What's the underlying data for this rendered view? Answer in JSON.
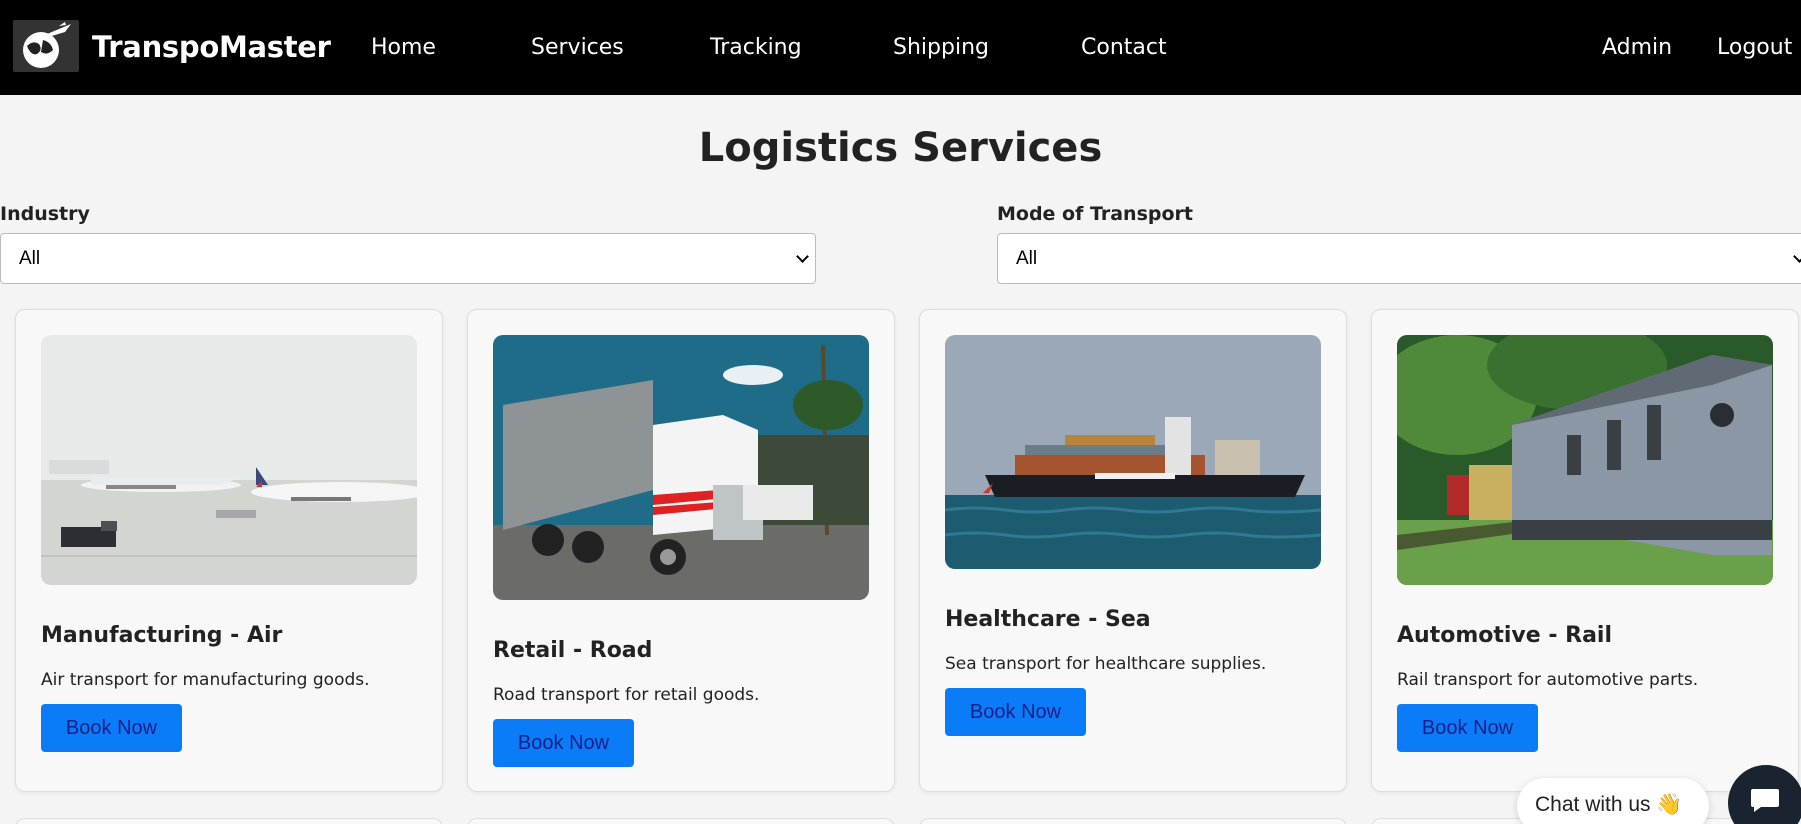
{
  "navbar": {
    "brand": "TranspoMaster",
    "logo_icon": "globe-plane-logo-icon",
    "links": [
      "Home",
      "Services",
      "Tracking",
      "Shipping",
      "Contact"
    ],
    "right_links": [
      "Admin",
      "Logout"
    ]
  },
  "page": {
    "title": "Logistics Services"
  },
  "filters": {
    "industry": {
      "label": "Industry",
      "value": "All"
    },
    "transport": {
      "label": "Mode of Transport",
      "value": "All"
    }
  },
  "cards": [
    {
      "title": "Manufacturing - Air",
      "description": "Air transport for manufacturing goods.",
      "button": "Book Now",
      "image_icon": "airplanes-photo"
    },
    {
      "title": "Retail - Road",
      "description": "Road transport for retail goods.",
      "button": "Book Now",
      "image_icon": "truck-photo"
    },
    {
      "title": "Healthcare - Sea",
      "description": "Sea transport for healthcare supplies.",
      "button": "Book Now",
      "image_icon": "cargo-ship-photo"
    },
    {
      "title": "Automotive - Rail",
      "description": "Rail transport for automotive parts.",
      "button": "Book Now",
      "image_icon": "train-photo"
    }
  ],
  "chat": {
    "label": "Chat with us 👋",
    "icon": "chat-bubble-icon"
  },
  "colors": {
    "navbar": "#000000",
    "button": "#0a7cf8",
    "background": "#f4f4f5"
  }
}
